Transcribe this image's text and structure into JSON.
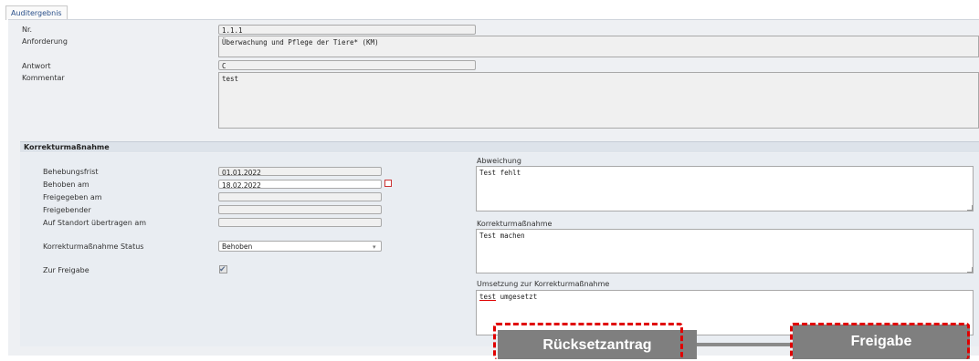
{
  "tab": {
    "label": "Auditergebnis"
  },
  "audit": {
    "nr_label": "Nr.",
    "nr_value": "1.1.1",
    "anforderung_label": "Anforderung",
    "anforderung_value": "Überwachung und Pflege der Tiere* (KM)",
    "antwort_label": "Antwort",
    "antwort_value": "C",
    "kommentar_label": "Kommentar",
    "kommentar_value": "test"
  },
  "korrektur": {
    "section_title": "Korrekturmaßnahme",
    "behebungsfrist_label": "Behebungsfrist",
    "behebungsfrist_value": "01.01.2022",
    "behoben_am_label": "Behoben am",
    "behoben_am_value": "18.02.2022",
    "freigegeben_am_label": "Freigegeben am",
    "freigegeben_am_value": "",
    "freigebender_label": "Freigebender",
    "freigebender_value": "",
    "standort_label": "Auf Standort übertragen am",
    "standort_value": "",
    "status_label": "Korrekturmaßnahme Status",
    "status_value": "Behoben",
    "zur_freigabe_label": "Zur Freigabe",
    "zur_freigabe_checked": true,
    "abweichung_label": "Abweichung",
    "abweichung_value": "Test fehlt",
    "massnahme_label": "Korrekturmaßnahme",
    "massnahme_value": "Test machen",
    "umsetzung_label": "Umsetzung zur Korrekturmaßnahme",
    "umsetzung_value_word1": "test",
    "umsetzung_value_rest": " umgesetzt"
  },
  "buttons": {
    "ruecksetzantrag": "Rücksetzantrag",
    "freigabe": "Freigabe"
  },
  "colors": {
    "highlight_dash": "#e00000",
    "button_bg": "#7f7f7f"
  }
}
